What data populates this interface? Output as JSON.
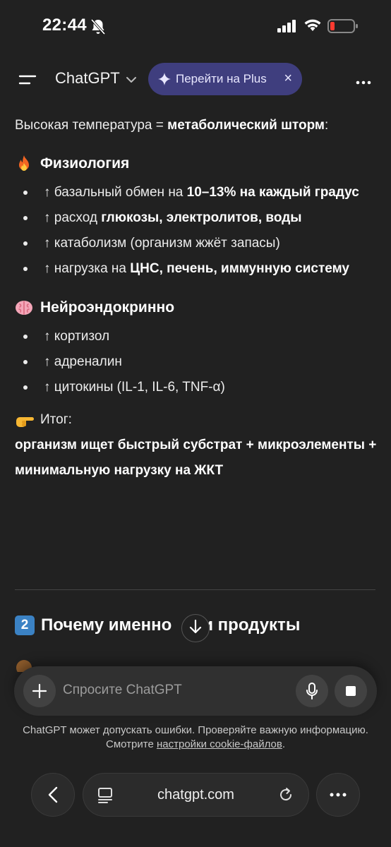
{
  "status_bar": {
    "time": "22:44"
  },
  "header": {
    "title": "ChatGPT",
    "plus_button_label": "Перейти на Plus",
    "plus_close": "×"
  },
  "message": {
    "intro_text": "Высокая температура = ",
    "intro_bold": "метаболический шторм",
    "intro_end": ":",
    "physiology": {
      "title": "Физиология",
      "icon": "fire-emoji",
      "items": [
        {
          "pre": "↑ базальный обмен на ",
          "bold": "10–13% на каждый градус",
          "post": ""
        },
        {
          "pre": "↑ расход ",
          "bold": "глюкозы, электролитов, воды",
          "post": ""
        },
        {
          "pre": "↑ катаболизм (организм жжёт запасы)",
          "bold": "",
          "post": ""
        },
        {
          "pre": "↑ нагрузка на ",
          "bold": "ЦНС, печень, иммунную систему",
          "post": ""
        }
      ]
    },
    "neuro": {
      "title": "Нейроэндокринно",
      "icon": "brain-emoji",
      "items": [
        {
          "pre": "↑ кортизол",
          "bold": "",
          "post": ""
        },
        {
          "pre": "↑ адреналин",
          "bold": "",
          "post": ""
        },
        {
          "pre": "↑ цитокины (IL-1, IL-6, TNF-α)",
          "bold": "",
          "post": ""
        }
      ]
    },
    "summary_label": "Итог:",
    "summary_icon": "pointing-hand-emoji",
    "summary_text": "организм ищет быстрый субстрат + микроэлементы + минимальную нагрузку на ЖКТ",
    "section2_number": "2",
    "section2_title": "Почему именно",
    "section2_title_end": "и продукты"
  },
  "composer": {
    "placeholder": "Спросите ChatGPT"
  },
  "disclaimer": {
    "text": "ChatGPT может допускать ошибки. Проверяйте важную информацию. Смотрите ",
    "link": "настройки cookie-файлов",
    "end": "."
  },
  "browser": {
    "url": "chatgpt.com"
  },
  "colors": {
    "background": "#212121",
    "plus_pill": "#3f3e7e",
    "battery_low": "#ff3b30",
    "badge": "#3b82c4"
  }
}
